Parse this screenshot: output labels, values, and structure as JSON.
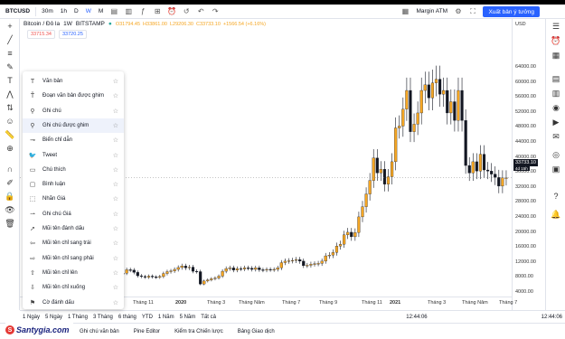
{
  "toolbar": {
    "symbol": "BTCUSD",
    "interval": "30m",
    "interval_1h": "1h",
    "interval_d": "D",
    "interval_w": "W",
    "interval_m": "M",
    "layout_name": "Margin ATM",
    "publish_label": "Xuất bản ý tưởng"
  },
  "legend": {
    "title": "Bitcoin / Đô la",
    "period": "1W",
    "exchange": "BITSTAMP",
    "o": "O31794.45",
    "h": "H33861.00",
    "l": "L29206.30",
    "c": "C33733.10",
    "chg": "+1566.54 (+6.16%)"
  },
  "price_boxes": {
    "sell": "33715.34",
    "buy": "33720.25"
  },
  "price_axis": {
    "currency": "USD",
    "labels": [
      "64000.00",
      "60000.00",
      "56000.00",
      "52000.00",
      "48000.00",
      "44000.00",
      "40000.00",
      "36000.00",
      "32000.00",
      "28000.00",
      "24000.00",
      "20000.00",
      "16000.00",
      "12000.00",
      "8000.00",
      "4000.00"
    ],
    "current_price": "33733.10",
    "current_sub": "4d 15h"
  },
  "time_axis": {
    "labels": [
      "Tháng 11",
      "2020",
      "Tháng 3",
      "Tháng Năm",
      "Tháng 7",
      "Tháng 9",
      "Tháng 11",
      "2021",
      "Tháng 3",
      "Tháng Năm",
      "Tháng 7"
    ]
  },
  "range_bar": {
    "items": [
      "1 Ngày",
      "5 Ngày",
      "1 Tháng",
      "3 Tháng",
      "6 tháng",
      "YTD",
      "1 Năm",
      "5 Năm",
      "Tất cả"
    ],
    "time": "12:44:06",
    "time_right": "12:44:06"
  },
  "bottom_tabs": {
    "items": [
      "Ghi chú văn bản",
      "Pine Editor",
      "Kiểm tra Chiến lược",
      "Bảng Giao dịch"
    ]
  },
  "watermark": {
    "text": "Santygia.com",
    "logo": "S"
  },
  "dropdown": {
    "items": [
      {
        "label": "Văn bản",
        "icon": "text-icon"
      },
      {
        "label": "Đoạn văn bản được ghim",
        "icon": "pinned-text-icon"
      },
      {
        "label": "Ghi chú",
        "icon": "note-icon"
      },
      {
        "label": "Ghi chú được ghim",
        "icon": "pinned-note-icon"
      },
      {
        "label": "Biển chỉ dẫn",
        "icon": "signpost-icon"
      },
      {
        "label": "Tweet",
        "icon": "tweet-icon"
      },
      {
        "label": "Chú thích",
        "icon": "callout-icon"
      },
      {
        "label": "Bình luận",
        "icon": "comment-icon"
      },
      {
        "label": "Nhãn Giá",
        "icon": "price-label-icon"
      },
      {
        "label": "Ghi chú Giá",
        "icon": "price-note-icon"
      },
      {
        "label": "Mũi tên đánh dấu",
        "icon": "arrow-marker-icon"
      },
      {
        "label": "Mũi tên chỉ sang trái",
        "icon": "arrow-left-icon"
      },
      {
        "label": "Mũi tên chỉ sang phải",
        "icon": "arrow-right-icon"
      },
      {
        "label": "Mũi tên chỉ lên",
        "icon": "arrow-up-icon"
      },
      {
        "label": "Mũi tên chỉ xuống",
        "icon": "arrow-down-icon"
      },
      {
        "label": "Cờ đánh dấu",
        "icon": "flag-icon"
      }
    ]
  },
  "colors": {
    "up": "#f5a623",
    "down": "#131722",
    "accent": "#2962ff"
  }
}
